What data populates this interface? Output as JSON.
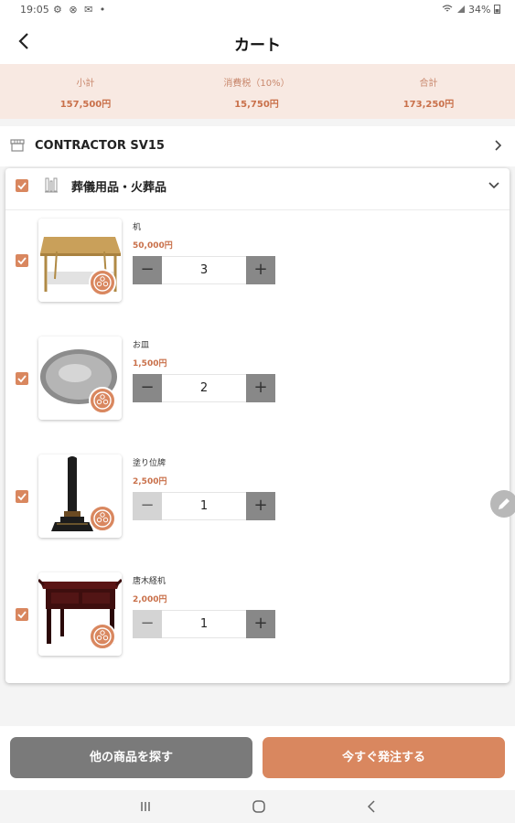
{
  "status_bar": {
    "time": "19:05",
    "left_icons": "⚙ ⊗ ✉ •",
    "battery": "34%"
  },
  "header": {
    "title": "カート"
  },
  "summary": {
    "subtotal_label": "小計",
    "subtotal_value": "157,500円",
    "tax_label": "消費税（10%）",
    "tax_value": "15,750円",
    "total_label": "合計",
    "total_value": "173,250円"
  },
  "store": {
    "name": "CONTRACTOR SV15"
  },
  "category": {
    "name": "葬儀用品・火葬品",
    "checked": true
  },
  "items": [
    {
      "name": "机",
      "price": "50,000円",
      "qty": "3",
      "minus_enabled": true
    },
    {
      "name": "お皿",
      "price": "1,500円",
      "qty": "2",
      "minus_enabled": true
    },
    {
      "name": "塗り位牌",
      "price": "2,500円",
      "qty": "1",
      "minus_enabled": false
    },
    {
      "name": "唐木経机",
      "price": "2,000円",
      "qty": "1",
      "minus_enabled": false
    }
  ],
  "stepper": {
    "minus_symbol": "−",
    "plus_symbol": "+"
  },
  "footer": {
    "browse_label": "他の商品を探す",
    "order_label": "今すぐ発注する"
  },
  "colors": {
    "accent": "#d9875f",
    "summary_bg": "#f8e9e2",
    "button_gray": "#7a7a7a"
  }
}
